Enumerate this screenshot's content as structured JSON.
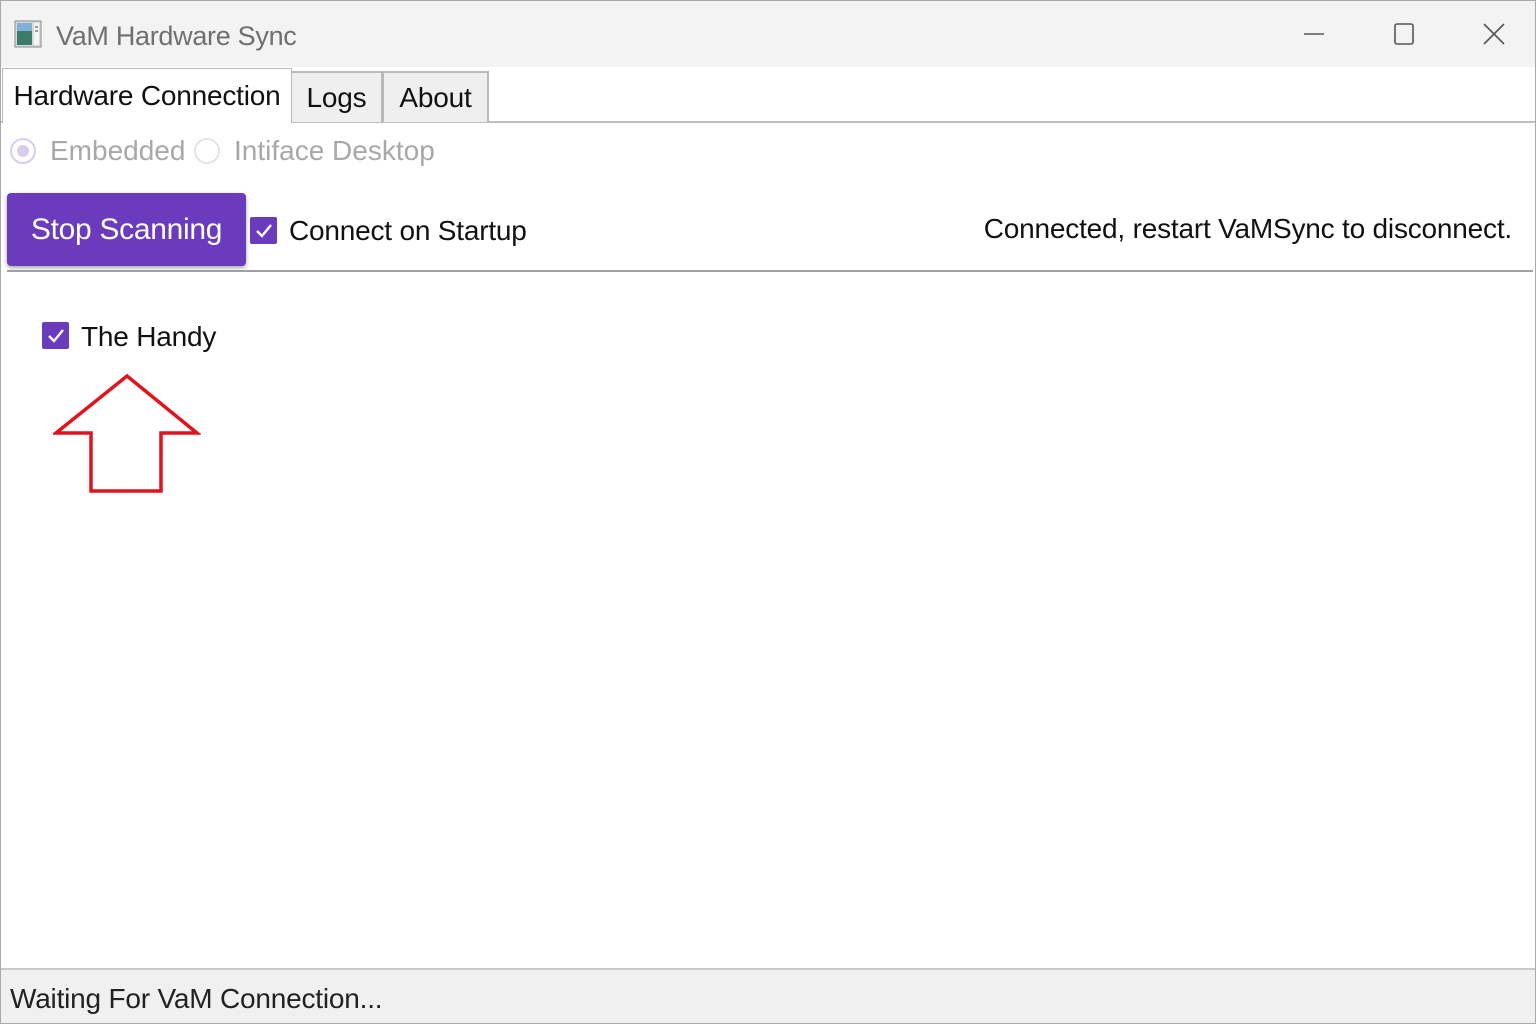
{
  "window": {
    "title": "VaM Hardware Sync",
    "icon": "app-window-icon",
    "controls": [
      "minimize-icon",
      "maximize-icon",
      "close-icon"
    ]
  },
  "tabs": [
    {
      "label": "Hardware Connection",
      "active": true
    },
    {
      "label": "Logs",
      "active": false
    },
    {
      "label": "About",
      "active": false
    }
  ],
  "connection_mode": {
    "options": [
      {
        "label": "Embedded",
        "selected": true,
        "enabled": false
      },
      {
        "label": "Intiface Desktop",
        "selected": false,
        "enabled": false
      }
    ]
  },
  "toolbar": {
    "scan_button_label": "Stop Scanning",
    "connect_on_startup_label": "Connect on Startup",
    "connect_on_startup_checked": true,
    "status_message": "Connected, restart VaMSync to disconnect."
  },
  "devices": [
    {
      "label": "The Handy",
      "checked": true
    }
  ],
  "annotation": {
    "icon": "red-up-arrow-icon",
    "color": "#e0141e"
  },
  "status_bar": {
    "text": "Waiting For VaM Connection..."
  },
  "colors": {
    "accent": "#6a3bbd",
    "arrow": "#e0141e"
  }
}
